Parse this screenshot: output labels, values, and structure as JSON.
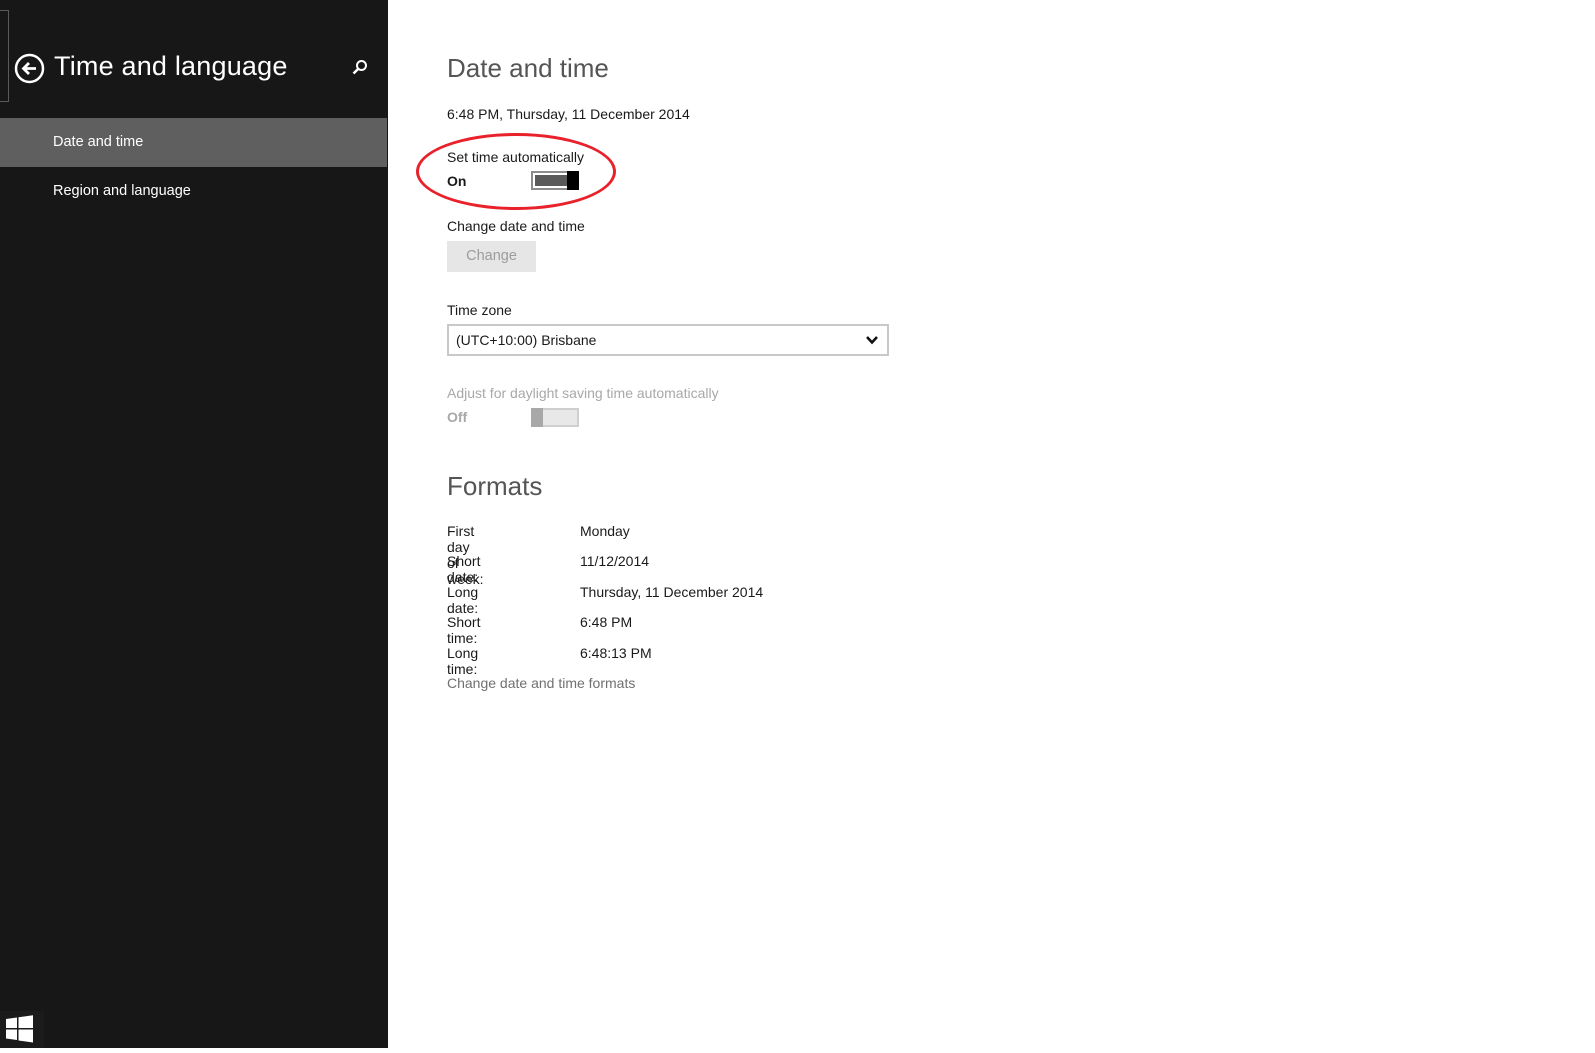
{
  "sidebar": {
    "title": "Time and language",
    "back_icon": "back-arrow-circle-icon",
    "search_icon": "search-icon",
    "items": [
      {
        "label": "Date and time",
        "selected": true
      },
      {
        "label": "Region and language",
        "selected": false
      }
    ],
    "start_icon": "windows-logo-icon"
  },
  "date_time": {
    "heading": "Date and time",
    "current": "6:48 PM, Thursday, 11 December 2014",
    "set_auto": {
      "label": "Set time automatically",
      "state": "On"
    },
    "change": {
      "label": "Change date and time",
      "button": "Change"
    },
    "time_zone": {
      "label": "Time zone",
      "value": "(UTC+10:00) Brisbane"
    },
    "dst": {
      "label": "Adjust for daylight saving time automatically",
      "state": "Off"
    }
  },
  "formats": {
    "heading": "Formats",
    "rows": [
      {
        "label": "First day of week:",
        "value": "Monday"
      },
      {
        "label": "Short date:",
        "value": "11/12/2014"
      },
      {
        "label": "Long date:",
        "value": "Thursday, 11 December 2014"
      },
      {
        "label": "Short time:",
        "value": "6:48 PM"
      },
      {
        "label": "Long time:",
        "value": "6:48:13 PM"
      }
    ],
    "link": "Change date and time formats"
  },
  "colors": {
    "sidebar_bg": "#171717",
    "selected_item_bg": "#5f5f5f",
    "annotation": "#e8212b"
  }
}
